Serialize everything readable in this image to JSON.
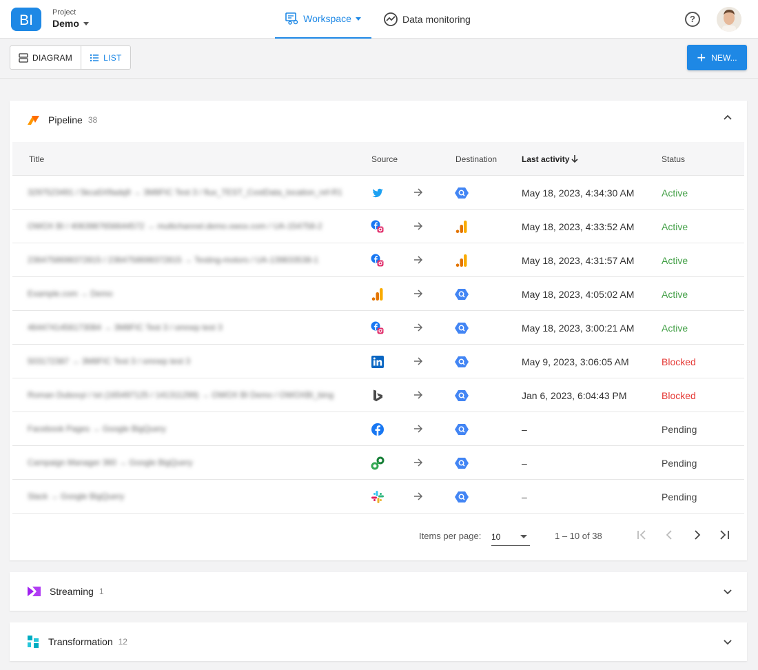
{
  "header": {
    "logo_text": "BI",
    "project_label": "Project",
    "project_name": "Demo",
    "tabs": [
      {
        "label": "Workspace",
        "active": true
      },
      {
        "label": "Data monitoring",
        "active": false
      }
    ],
    "help_label": "?"
  },
  "toolbar": {
    "view_diagram": "DIAGRAM",
    "view_list": "LIST",
    "new_label": "NEW..."
  },
  "pipeline": {
    "title": "Pipeline",
    "count": "38",
    "columns": {
      "title": "Title",
      "source": "Source",
      "destination": "Destination",
      "last_activity": "Last activity",
      "status": "Status"
    },
    "rows": [
      {
        "title": "3297523491 / 5kca5Xfladq9 → 3M8FIC Test 3 / flux_TEST_CostData_location_ref-R1",
        "source_icon": "twitter-icon",
        "dest_icon": "bigquery-icon",
        "last_activity": "May 18, 2023, 4:34:30 AM",
        "status": "Active"
      },
      {
        "title": "OWOX BI / 4063987656644572 → multichannel.demo.owox.com / UA-154758-2",
        "source_icon": "facebook-instagram-icon",
        "dest_icon": "google-analytics-icon",
        "last_activity": "May 18, 2023, 4:33:52 AM",
        "status": "Active"
      },
      {
        "title": "2364758698372815 / 2364758698372815 → Testing-motors / UA-139833538-1",
        "source_icon": "facebook-instagram-icon",
        "dest_icon": "google-analytics-icon",
        "last_activity": "May 18, 2023, 4:31:57 AM",
        "status": "Active"
      },
      {
        "title": "Example.com → Demo",
        "source_icon": "google-analytics-icon",
        "dest_icon": "bigquery-icon",
        "last_activity": "May 18, 2023, 4:05:02 AM",
        "status": "Active"
      },
      {
        "title": "4644741456173084 → 3M8FIC Test 3 / omnep test 3",
        "source_icon": "facebook-instagram-icon",
        "dest_icon": "bigquery-icon",
        "last_activity": "May 18, 2023, 3:00:21 AM",
        "status": "Active"
      },
      {
        "title": "503172387 → 3M8FIC Test 3 / omnep test 3",
        "source_icon": "linkedin-icon",
        "dest_icon": "bigquery-icon",
        "last_activity": "May 9, 2023, 3:06:05 AM",
        "status": "Blocked"
      },
      {
        "title": "Roman Dubovyi / txt (165497125 / 141311299) → OWOX BI Demo / OWOXBI_bing",
        "source_icon": "bing-icon",
        "dest_icon": "bigquery-icon",
        "last_activity": "Jan 6, 2023, 6:04:43 PM",
        "status": "Blocked"
      },
      {
        "title": "Facebook Pages → Google BigQuery",
        "source_icon": "facebook-icon",
        "dest_icon": "bigquery-icon",
        "last_activity": "–",
        "status": "Pending"
      },
      {
        "title": "Campaign Manager 360 → Google BigQuery",
        "source_icon": "campaign-manager-icon",
        "dest_icon": "bigquery-icon",
        "last_activity": "–",
        "status": "Pending"
      },
      {
        "title": "Slack → Google BigQuery",
        "source_icon": "slack-icon",
        "dest_icon": "bigquery-icon",
        "last_activity": "–",
        "status": "Pending"
      }
    ],
    "paginator": {
      "items_label": "Items per page:",
      "page_size": "10",
      "range": "1 – 10 of 38"
    }
  },
  "streaming": {
    "title": "Streaming",
    "count": "1"
  },
  "transformation": {
    "title": "Transformation",
    "count": "12"
  },
  "colors": {
    "accent": "#1e88e5",
    "active": "#43a047",
    "blocked": "#e53935"
  }
}
